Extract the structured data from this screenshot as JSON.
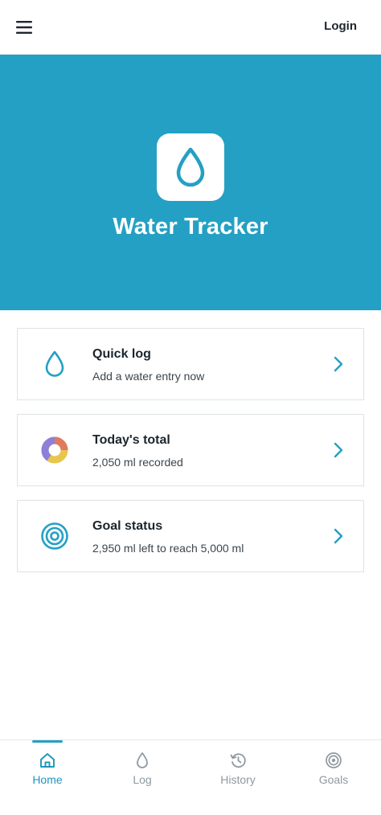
{
  "header": {
    "menu_icon": "hamburger-menu-icon",
    "login_label": "Login"
  },
  "hero": {
    "icon": "water-drop-icon",
    "title": "Water Tracker"
  },
  "cards": [
    {
      "icon": "water-drop-icon",
      "title": "Quick log",
      "subtitle": "Add a water entry now"
    },
    {
      "icon": "donut-chart-icon",
      "title": "Today's total",
      "subtitle": "2,050 ml recorded"
    },
    {
      "icon": "target-icon",
      "title": "Goal status",
      "subtitle": "2,950 ml left to reach 5,000 ml"
    }
  ],
  "bottom_nav": {
    "active": "Home",
    "items": [
      {
        "label": "Home",
        "icon": "home-icon"
      },
      {
        "label": "Log",
        "icon": "water-drop-icon"
      },
      {
        "label": "History",
        "icon": "history-icon"
      },
      {
        "label": "Goals",
        "icon": "target-icon"
      }
    ]
  },
  "colors": {
    "accent": "#24a0c4",
    "active_nav": "#1f96bb",
    "inactive_nav": "#8f999f",
    "donut_purple": "#8e7fd8",
    "donut_orange": "#e0795f",
    "donut_yellow": "#e6c64d"
  }
}
